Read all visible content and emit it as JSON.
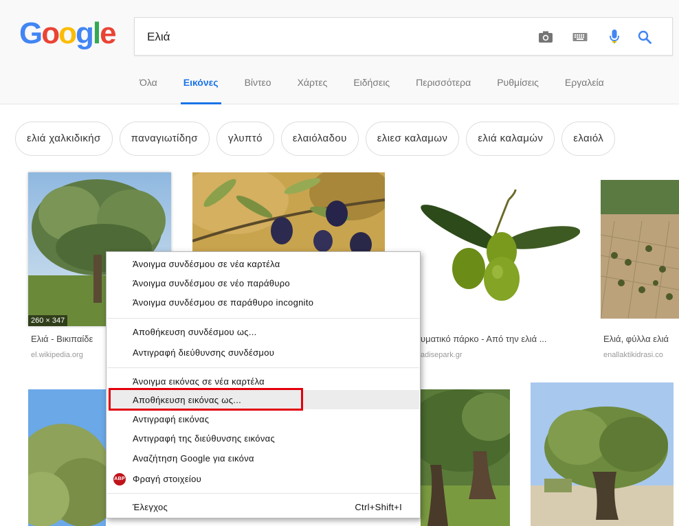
{
  "logo": {
    "letters": [
      "G",
      "o",
      "o",
      "g",
      "l",
      "e"
    ],
    "colors": [
      "#4285f4",
      "#ea4335",
      "#fbbc05",
      "#4285f4",
      "#34a853",
      "#ea4335"
    ]
  },
  "search": {
    "query": "Ελιά"
  },
  "icons": {
    "camera": "camera-icon",
    "keyboard": "keyboard-icon",
    "mic": "microphone-icon",
    "search": "search-icon"
  },
  "tabs": [
    "Όλα",
    "Εικόνες",
    "Βίντεο",
    "Χάρτες",
    "Ειδήσεις",
    "Περισσότερα",
    "Ρυθμίσεις",
    "Εργαλεία"
  ],
  "active_tab": "Εικόνες",
  "chips": [
    "ελιά χαλκιδικήσ",
    "παναγιωτίδησ",
    "γλυπτό",
    "ελαιόλαδου",
    "ελιεσ καλαμων",
    "ελιά καλαμών",
    "ελαιόλ"
  ],
  "results": [
    {
      "dims": "260 × 347",
      "caption": "Ελιά - Βικιπαίδε",
      "source": "el.wikipedia.org"
    },
    {
      "caption": "υματικό πάρκο - Από την ελιά ...",
      "source": "adisepark.gr"
    },
    {
      "caption": "Ελιά, φύλλα ελιά",
      "source": "enallaktikidrasi.co"
    }
  ],
  "context_menu": {
    "items": [
      "Άνοιγμα συνδέσμου σε νέα καρτέλα",
      "Άνοιγμα συνδέσμου σε νέο παράθυρο",
      "Άνοιγμα συνδέσμου σε παράθυρο incognito",
      "Αποθήκευση συνδέσμου ως...",
      "Αντιγραφή διεύθυνσης συνδέσμου",
      "Άνοιγμα εικόνας σε νέα καρτέλα",
      "Αποθήκευση εικόνας ως...",
      "Αντιγραφή εικόνας",
      "Αντιγραφή της διεύθυνσης εικόνας",
      "Αναζήτηση Google για εικόνα",
      "Φραγή στοιχείου",
      "Έλεγχος"
    ],
    "abp_label": "ABP",
    "inspect_shortcut": "Ctrl+Shift+I",
    "highlighted": "Αποθήκευση εικόνας ως..."
  }
}
